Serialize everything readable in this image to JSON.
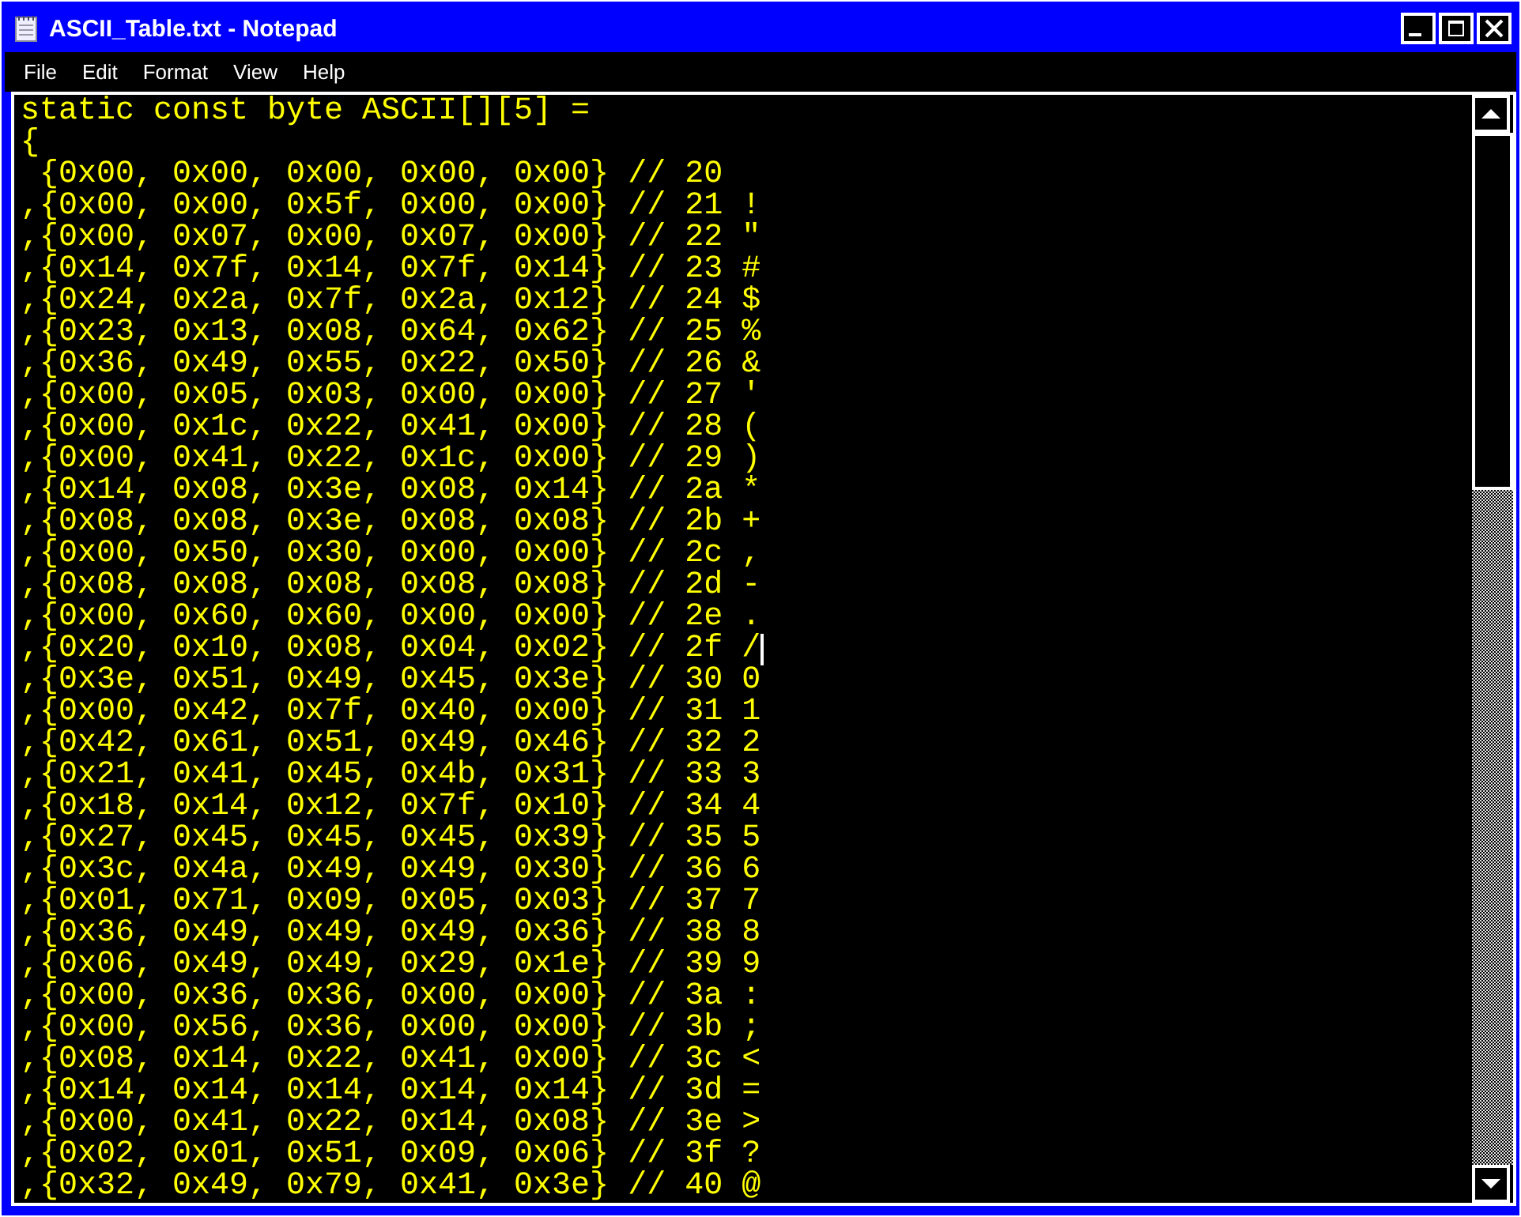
{
  "window": {
    "title": "ASCII_Table.txt - Notepad"
  },
  "menu": [
    "File",
    "Edit",
    "Format",
    "View",
    "Help"
  ],
  "editor": {
    "lines": [
      {
        "text": "static const byte ASCII[][5] =",
        "caret": false
      },
      {
        "text": "{",
        "caret": false
      },
      {
        "text": " {0x00, 0x00, 0x00, 0x00, 0x00} // 20",
        "caret": false
      },
      {
        "text": ",{0x00, 0x00, 0x5f, 0x00, 0x00} // 21 !",
        "caret": false
      },
      {
        "text": ",{0x00, 0x07, 0x00, 0x07, 0x00} // 22 \"",
        "caret": false
      },
      {
        "text": ",{0x14, 0x7f, 0x14, 0x7f, 0x14} // 23 #",
        "caret": false
      },
      {
        "text": ",{0x24, 0x2a, 0x7f, 0x2a, 0x12} // 24 $",
        "caret": false
      },
      {
        "text": ",{0x23, 0x13, 0x08, 0x64, 0x62} // 25 %",
        "caret": false
      },
      {
        "text": ",{0x36, 0x49, 0x55, 0x22, 0x50} // 26 &",
        "caret": false
      },
      {
        "text": ",{0x00, 0x05, 0x03, 0x00, 0x00} // 27 '",
        "caret": false
      },
      {
        "text": ",{0x00, 0x1c, 0x22, 0x41, 0x00} // 28 (",
        "caret": false
      },
      {
        "text": ",{0x00, 0x41, 0x22, 0x1c, 0x00} // 29 )",
        "caret": false
      },
      {
        "text": ",{0x14, 0x08, 0x3e, 0x08, 0x14} // 2a *",
        "caret": false
      },
      {
        "text": ",{0x08, 0x08, 0x3e, 0x08, 0x08} // 2b +",
        "caret": false
      },
      {
        "text": ",{0x00, 0x50, 0x30, 0x00, 0x00} // 2c ,",
        "caret": false
      },
      {
        "text": ",{0x08, 0x08, 0x08, 0x08, 0x08} // 2d -",
        "caret": false
      },
      {
        "text": ",{0x00, 0x60, 0x60, 0x00, 0x00} // 2e .",
        "caret": false
      },
      {
        "text": ",{0x20, 0x10, 0x08, 0x04, 0x02} // 2f /",
        "caret": true
      },
      {
        "text": ",{0x3e, 0x51, 0x49, 0x45, 0x3e} // 30 0",
        "caret": false
      },
      {
        "text": ",{0x00, 0x42, 0x7f, 0x40, 0x00} // 31 1",
        "caret": false
      },
      {
        "text": ",{0x42, 0x61, 0x51, 0x49, 0x46} // 32 2",
        "caret": false
      },
      {
        "text": ",{0x21, 0x41, 0x45, 0x4b, 0x31} // 33 3",
        "caret": false
      },
      {
        "text": ",{0x18, 0x14, 0x12, 0x7f, 0x10} // 34 4",
        "caret": false
      },
      {
        "text": ",{0x27, 0x45, 0x45, 0x45, 0x39} // 35 5",
        "caret": false
      },
      {
        "text": ",{0x3c, 0x4a, 0x49, 0x49, 0x30} // 36 6",
        "caret": false
      },
      {
        "text": ",{0x01, 0x71, 0x09, 0x05, 0x03} // 37 7",
        "caret": false
      },
      {
        "text": ",{0x36, 0x49, 0x49, 0x49, 0x36} // 38 8",
        "caret": false
      },
      {
        "text": ",{0x06, 0x49, 0x49, 0x29, 0x1e} // 39 9",
        "caret": false
      },
      {
        "text": ",{0x00, 0x36, 0x36, 0x00, 0x00} // 3a :",
        "caret": false
      },
      {
        "text": ",{0x00, 0x56, 0x36, 0x00, 0x00} // 3b ;",
        "caret": false
      },
      {
        "text": ",{0x08, 0x14, 0x22, 0x41, 0x00} // 3c <",
        "caret": false
      },
      {
        "text": ",{0x14, 0x14, 0x14, 0x14, 0x14} // 3d =",
        "caret": false
      },
      {
        "text": ",{0x00, 0x41, 0x22, 0x14, 0x08} // 3e >",
        "caret": false
      },
      {
        "text": ",{0x02, 0x01, 0x51, 0x09, 0x06} // 3f ?",
        "caret": false
      },
      {
        "text": ",{0x32, 0x49, 0x79, 0x41, 0x3e} // 40 @",
        "caret": false
      }
    ]
  }
}
